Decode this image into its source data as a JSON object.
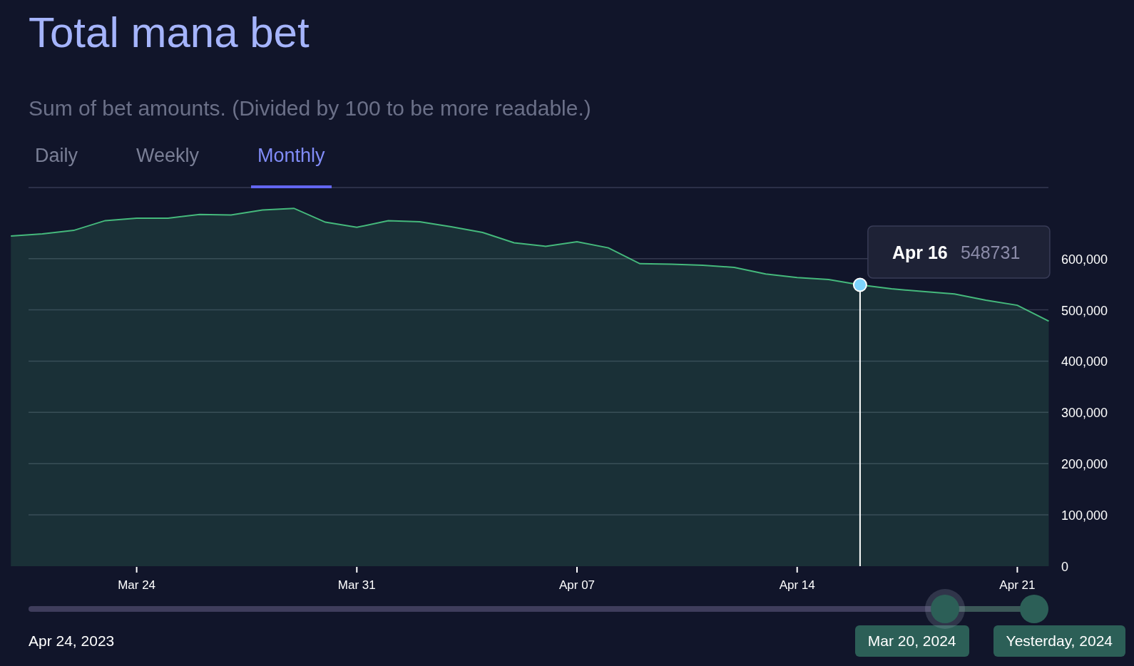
{
  "title": "Total mana bet",
  "subtitle": "Sum of bet amounts. (Divided by 100 to be more readable.)",
  "tabs": [
    {
      "label": "Daily",
      "selected": false
    },
    {
      "label": "Weekly",
      "selected": false
    },
    {
      "label": "Monthly",
      "selected": true
    }
  ],
  "chart": {
    "chart_data": {
      "type": "area",
      "categories": [
        null,
        null,
        null,
        null,
        "Mar 24",
        null,
        null,
        null,
        null,
        null,
        null,
        "Mar 31",
        null,
        null,
        null,
        null,
        null,
        null,
        "Apr 07",
        null,
        null,
        null,
        null,
        null,
        null,
        "Apr 14",
        null,
        null,
        null,
        null,
        null,
        null,
        "Apr 21",
        null
      ],
      "series": [
        {
          "color": "#45b97c",
          "values": [
            644000,
            648000,
            655000,
            674000,
            679000,
            679000,
            686000,
            685000,
            695000,
            698000,
            671000,
            661000,
            674000,
            672000,
            662000,
            651000,
            631000,
            624000,
            633000,
            621000,
            590000,
            589000,
            587000,
            583000,
            570000,
            563000,
            559000,
            548731,
            541000,
            536000,
            531000,
            519000,
            509000,
            478000
          ]
        }
      ],
      "yticks": [
        {
          "value": 0,
          "label": "0"
        },
        {
          "value": 100000,
          "label": "100,000"
        },
        {
          "value": 200000,
          "label": "200,000"
        },
        {
          "value": 300000,
          "label": "300,000"
        },
        {
          "value": 400000,
          "label": "400,000"
        },
        {
          "value": 500000,
          "label": "500,000"
        },
        {
          "value": 600000,
          "label": "600,000"
        }
      ],
      "ylim": [
        0,
        740000
      ],
      "grid": true,
      "annotations": [
        "548731"
      ]
    },
    "tooltip": {
      "date": "Apr 16"
    }
  },
  "range": {
    "start_label": "Apr 24, 2023",
    "handles": [
      {
        "label": "Mar 20, 2024",
        "level": 0.91,
        "focused": true
      },
      {
        "label": "Yesterday, 2024",
        "level": 1,
        "focused": false
      }
    ]
  }
}
